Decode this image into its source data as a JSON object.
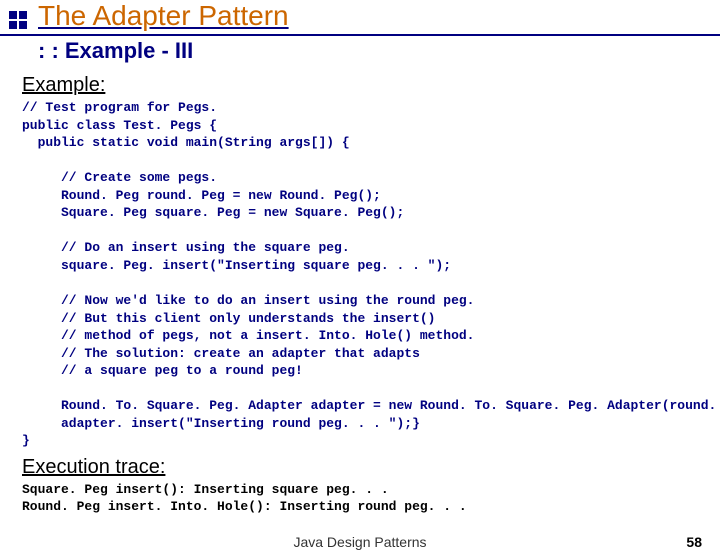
{
  "header": {
    "title": "The Adapter Pattern",
    "subtitle": ": : Example - III"
  },
  "example": {
    "label": "Example:",
    "code": "// Test program for Pegs.\npublic class Test. Pegs {\n  public static void main(String args[]) {\n\n     // Create some pegs.\n     Round. Peg round. Peg = new Round. Peg();\n     Square. Peg square. Peg = new Square. Peg();\n\n     // Do an insert using the square peg.\n     square. Peg. insert(\"Inserting square peg. . . \");\n\n     // Now we'd like to do an insert using the round peg.\n     // But this client only understands the insert()\n     // method of pegs, not a insert. Into. Hole() method.\n     // The solution: create an adapter that adapts\n     // a square peg to a round peg!\n\n     Round. To. Square. Peg. Adapter adapter = new Round. To. Square. Peg. Adapter(round. Peg);\n     adapter. insert(\"Inserting round peg. . . \");}\n}"
  },
  "execution": {
    "label": "Execution trace:",
    "output": "Square. Peg insert(): Inserting square peg. . .\nRound. Peg insert. Into. Hole(): Inserting round peg. . ."
  },
  "footer": {
    "center": "Java Design Patterns",
    "page": "58"
  }
}
